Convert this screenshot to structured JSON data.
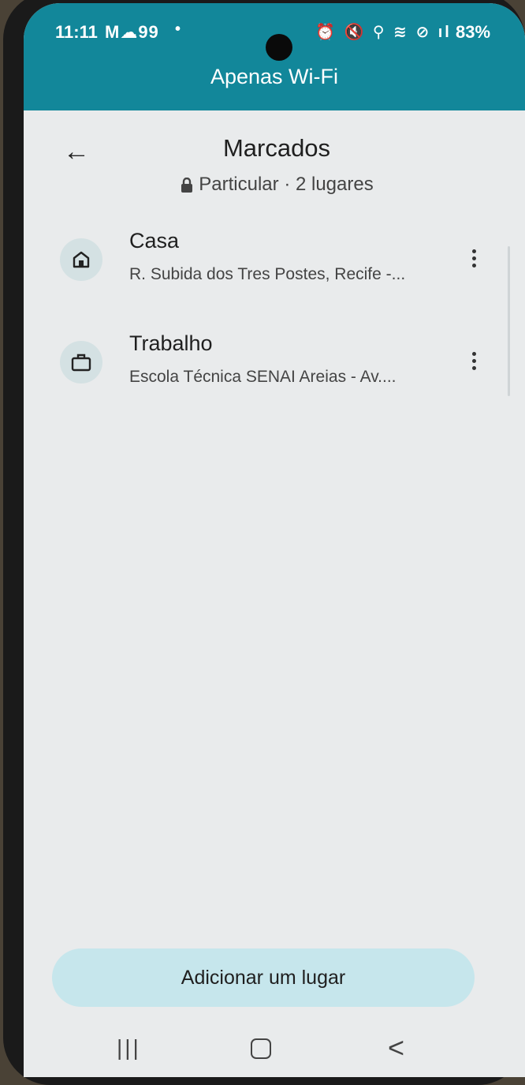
{
  "status_bar": {
    "time": "11:11",
    "left_icons": "M☁99",
    "battery": "83%"
  },
  "banner": {
    "title": "Apenas Wi-Fi"
  },
  "header": {
    "title": "Marcados",
    "subtitle": "Particular · 2 lugares"
  },
  "places": [
    {
      "name": "Casa",
      "address": "R. Subida dos Tres Postes, Recife -...",
      "icon": "home-icon"
    },
    {
      "name": "Trabalho",
      "address": "Escola Técnica SENAI Areias - Av....",
      "icon": "briefcase-icon"
    }
  ],
  "actions": {
    "add_place": "Adicionar um lugar"
  },
  "colors": {
    "banner": "#12879a",
    "button": "#c6e6ec",
    "icon_bg": "#d4e1e3",
    "background": "#e9ebec"
  }
}
